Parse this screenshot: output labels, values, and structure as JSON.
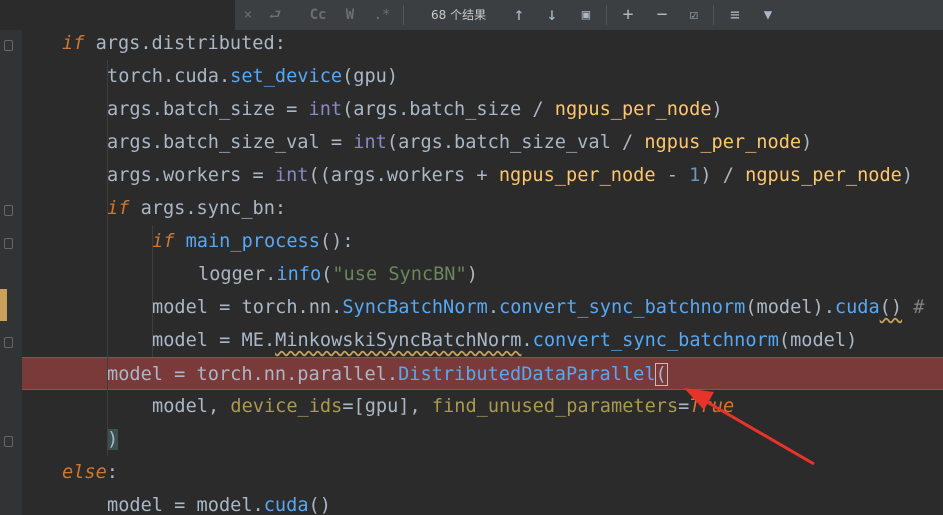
{
  "toolbar": {
    "result_count": "68 个结果",
    "close_glyph": "×",
    "newline_glyph": "⮐",
    "match_case_label": "Cc",
    "whole_words_label": "W",
    "regex_label": ".*",
    "up_glyph": "↑",
    "down_glyph": "↓",
    "select_all_glyph": "▣",
    "add_selection_glyph": "+",
    "remove_selection_glyph": "−",
    "toggle_selection_glyph": "☑",
    "multiline_glyph": "≡",
    "filter_glyph": "▼"
  },
  "code": {
    "l1": {
      "kw": "if",
      "rest": " args.distributed:"
    },
    "l2": {
      "a": "torch.cuda.",
      "fn": "set_device",
      "b": "(gpu)"
    },
    "l3": {
      "a": "args.batch_size = ",
      "bi": "int",
      "b": "(args.batch_size / ",
      "c": "ngpus_per_node",
      "d": ")"
    },
    "l4": {
      "a": "args.batch_size_val = ",
      "bi": "int",
      "b": "(args.batch_size_val / ",
      "c": "ngpus_per_node",
      "d": ")"
    },
    "l5": {
      "a": "args.workers = ",
      "bi": "int",
      "b": "((args.workers + ",
      "c": "ngpus_per_node",
      "d": " - ",
      "num": "1",
      "e": ") / ",
      "f": "ngpus_per_node",
      "g": ")"
    },
    "l6": {
      "kw": "if",
      "rest": " args.sync_bn:"
    },
    "l7": {
      "kw": "if",
      "sp": " ",
      "fn": "main_process",
      "rest": "():"
    },
    "l8": {
      "a": "logger.",
      "fn": "info",
      "b": "(",
      "str": "\"use SyncBN\"",
      "c": ")"
    },
    "l9": {
      "a": "model = torch.nn.",
      "cls": "SyncBatchNorm",
      "b": ".",
      "fn": "convert_sync_batchnorm",
      "c": "(model).",
      "fn2": "cuda",
      "d": "()",
      "cmt": " #"
    },
    "l10": {
      "a": "model = ME.",
      "cls": "MinkowskiSyncBatchNorm",
      "b": ".",
      "fn": "convert_sync_batchnorm",
      "c": "(model)"
    },
    "l11": {
      "a": "model = torch.nn.parallel.",
      "fn": "DistributedDataParallel",
      "b": "("
    },
    "l12": {
      "a": "model, ",
      "k1": "device_ids",
      "b": "=[gpu], ",
      "k2": "find_unused_parameters",
      "c": "=",
      "bool": "True"
    },
    "l13": {
      "a": ")"
    },
    "l14": {
      "kw": "else",
      "rest": ":"
    },
    "l15": {
      "a": "model = model.",
      "fn": "cuda",
      "b": "()"
    }
  },
  "colors": {
    "highlight": "#7a3a3a",
    "arrow": "#e8332a"
  }
}
